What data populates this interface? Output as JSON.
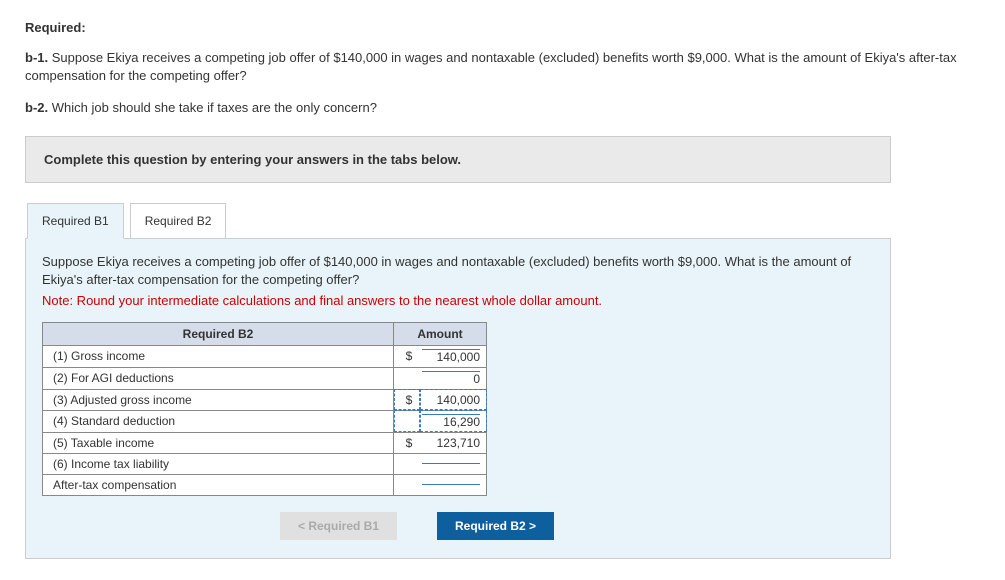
{
  "header": {
    "required_label": "Required:"
  },
  "questions": {
    "b1_label": "b-1.",
    "b1_text": "Suppose Ekiya receives a competing job offer of $140,000 in wages and nontaxable (excluded) benefits worth $9,000. What is the amount of Ekiya's after-tax compensation for the competing offer?",
    "b2_label": "b-2.",
    "b2_text": "Which job should she take if taxes are the only concern?"
  },
  "instruction": "Complete this question by entering your answers in the tabs below.",
  "tabs": {
    "b1": "Required B1",
    "b2": "Required B2"
  },
  "panel": {
    "prompt": "Suppose Ekiya receives a competing job offer of $140,000 in wages and nontaxable (excluded) benefits worth $9,000. What is the amount of Ekiya's after-tax compensation for the competing offer?",
    "note": "Note: Round your intermediate calculations and final answers to the nearest whole dollar amount."
  },
  "table": {
    "col1_header": "Required B2",
    "col2_header": "Amount",
    "rows": [
      {
        "label": "(1) Gross income",
        "currency": "$",
        "value": "140,000",
        "calc": false,
        "dashed": false,
        "editable": true
      },
      {
        "label": "(2) For AGI deductions",
        "currency": "",
        "value": "0",
        "calc": false,
        "dashed": false,
        "editable": true
      },
      {
        "label": "(3) Adjusted gross income",
        "currency": "$",
        "value": "140,000",
        "calc": true,
        "dashed": true,
        "editable": false
      },
      {
        "label": "(4) Standard deduction",
        "currency": "",
        "value": "16,290",
        "calc": false,
        "dashed": true,
        "editable": true
      },
      {
        "label": "(5) Taxable income",
        "currency": "$",
        "value": "123,710",
        "calc": true,
        "dashed": false,
        "editable": false
      },
      {
        "label": "(6) Income tax liability",
        "currency": "",
        "value": "",
        "calc": false,
        "dashed": false,
        "editable": true
      },
      {
        "label": "After-tax compensation",
        "currency": "",
        "value": "",
        "calc": false,
        "dashed": false,
        "editable": true
      }
    ]
  },
  "nav": {
    "prev_icon": "<",
    "prev_label": "Required B1",
    "next_label": "Required B2",
    "next_icon": ">"
  }
}
